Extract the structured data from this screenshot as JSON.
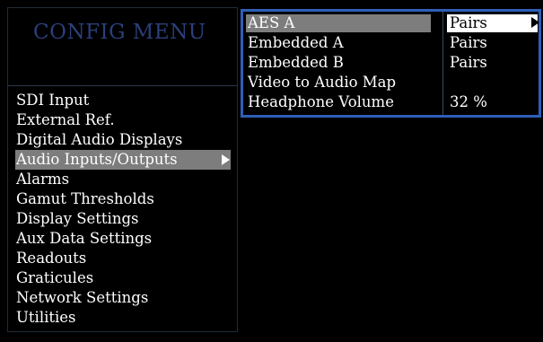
{
  "menu": {
    "title": "CONFIG MENU",
    "items": [
      {
        "label": "SDI Input"
      },
      {
        "label": "External Ref."
      },
      {
        "label": "Digital Audio Displays"
      },
      {
        "label": "Audio Inputs/Outputs",
        "selected": true
      },
      {
        "label": "Alarms"
      },
      {
        "label": "Gamut Thresholds"
      },
      {
        "label": "Display Settings"
      },
      {
        "label": "Aux Data Settings"
      },
      {
        "label": "Readouts"
      },
      {
        "label": "Graticules"
      },
      {
        "label": "Network Settings"
      },
      {
        "label": "Utilities"
      }
    ]
  },
  "submenu": {
    "rows": [
      {
        "label": "AES A",
        "value": "Pairs",
        "selected": true
      },
      {
        "label": "Embedded A",
        "value": "Pairs"
      },
      {
        "label": "Embedded B",
        "value": "Pairs"
      },
      {
        "label": "Video to Audio Map",
        "value": ""
      },
      {
        "label": "Headphone Volume",
        "value": "32 %"
      }
    ]
  },
  "colors": {
    "background": "#000000",
    "title": "#2b3f7a",
    "highlight": "#7d7d7d",
    "submenu_border": "#2e5fb8",
    "text": "#ffffff"
  },
  "icons": {
    "menu_arrow": "triangle-right-icon",
    "value_arrow": "triangle-right-icon"
  }
}
